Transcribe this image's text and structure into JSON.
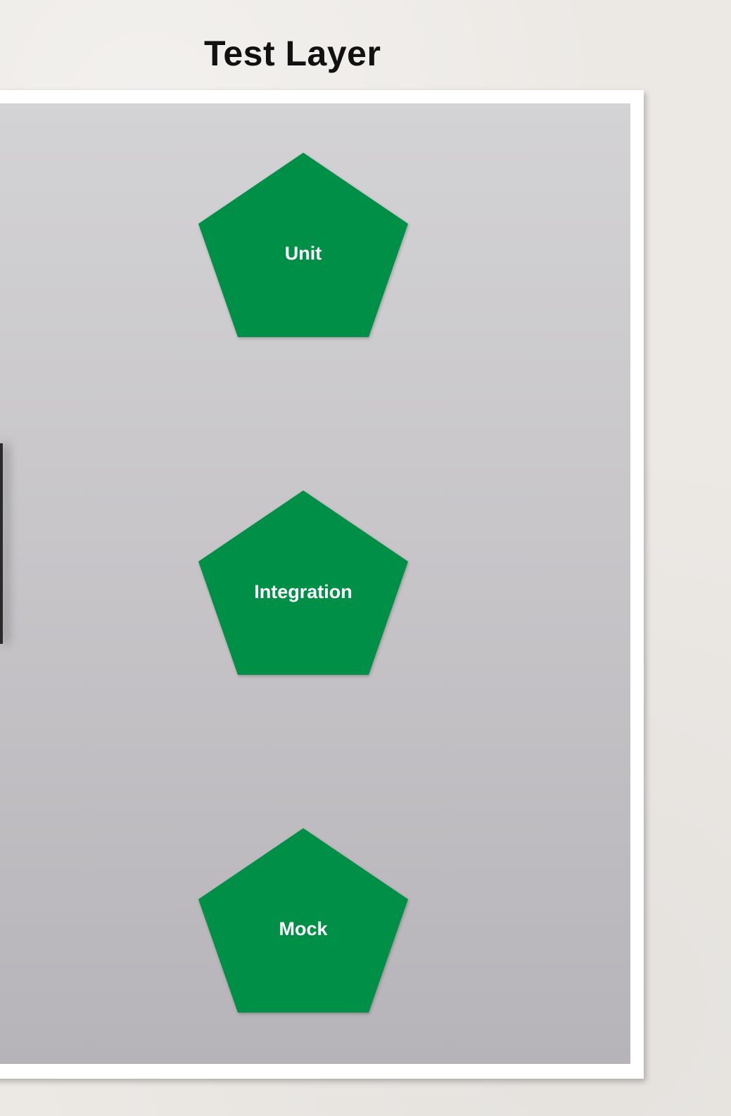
{
  "title": "Test Layer",
  "colors": {
    "node_fill": "#068f47",
    "panel_top": "#d3d2d4",
    "panel_bottom": "#b6b4b8",
    "frame": "#ffffff",
    "background": "#ece9e5"
  },
  "nodes": [
    {
      "label": "Unit",
      "shape": "pentagon"
    },
    {
      "label": "Integration",
      "shape": "pentagon"
    },
    {
      "label": "Mock",
      "shape": "pentagon"
    }
  ]
}
